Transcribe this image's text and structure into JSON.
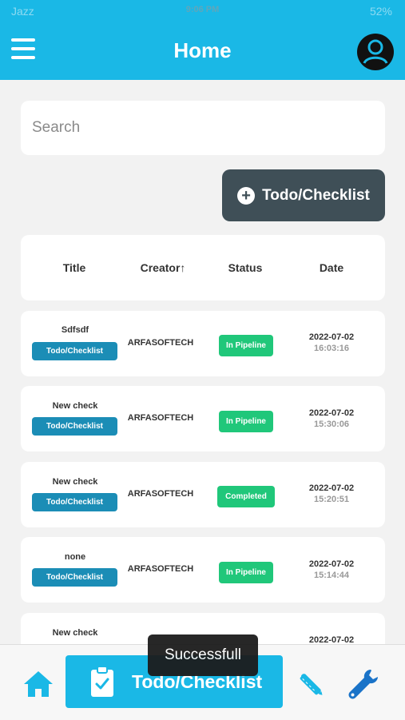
{
  "status_bar": {
    "carrier": "Jazz",
    "time": "9:06 PM",
    "battery": "52%"
  },
  "app_bar": {
    "title": "Home"
  },
  "search": {
    "placeholder": "Search"
  },
  "add_button": {
    "label": "Todo/Checklist"
  },
  "table": {
    "headers": {
      "title": "Title",
      "creator": "Creator↑",
      "status": "Status",
      "date": "Date"
    },
    "rows": [
      {
        "title": "Sdfsdf",
        "type": "Todo/Checklist",
        "creator": "ARFASOFTECH",
        "status": "In Pipeline",
        "date": "2022-07-02",
        "time": "16:03:16"
      },
      {
        "title": "New check",
        "type": "Todo/Checklist",
        "creator": "ARFASOFTECH",
        "status": "In Pipeline",
        "date": "2022-07-02",
        "time": "15:30:06"
      },
      {
        "title": "New check",
        "type": "Todo/Checklist",
        "creator": "ARFASOFTECH",
        "status": "Completed",
        "date": "2022-07-02",
        "time": "15:20:51"
      },
      {
        "title": "none",
        "type": "Todo/Checklist",
        "creator": "ARFASOFTECH",
        "status": "In Pipeline",
        "date": "2022-07-02",
        "time": "15:14:44"
      },
      {
        "title": "New check",
        "date": "2022-07-02"
      }
    ]
  },
  "bottom_nav": {
    "active_label": "Todo/Checklist"
  },
  "toast": {
    "text": "Successfull"
  },
  "colors": {
    "primary": "#1ab8e6",
    "dark_button": "#3f4f57",
    "tag": "#1b8db6",
    "status_green": "#20c77a",
    "wrench": "#1a73c8"
  }
}
